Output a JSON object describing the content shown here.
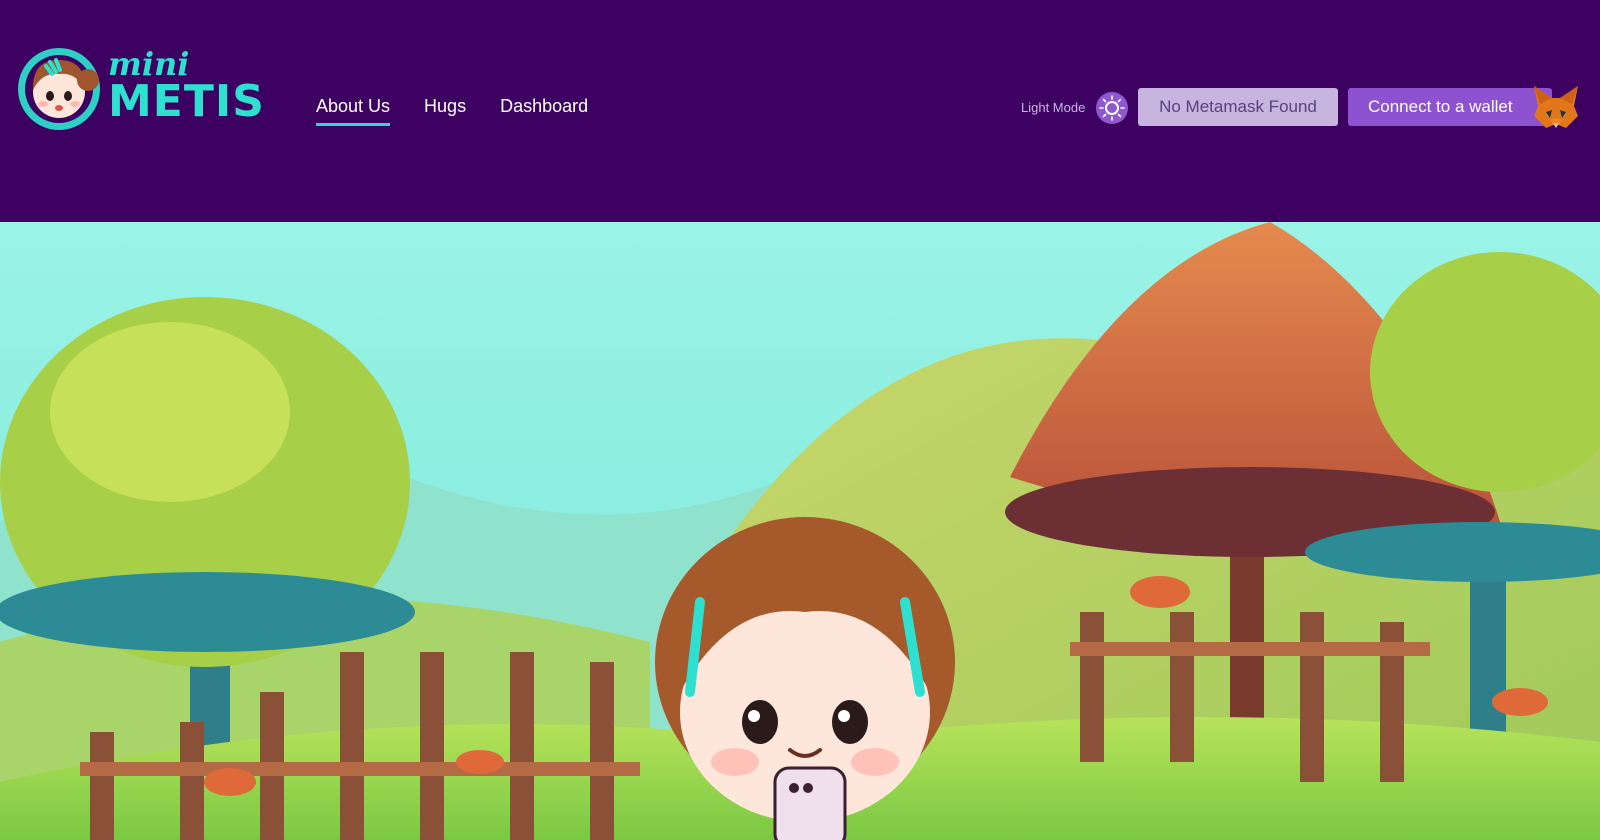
{
  "brand": {
    "mini": "mini",
    "metis": "METIS",
    "color": "#2de0cf"
  },
  "nav": {
    "items": [
      {
        "label": "About Us",
        "active": true
      },
      {
        "label": "Hugs",
        "active": false
      },
      {
        "label": "Dashboard",
        "active": false
      }
    ]
  },
  "header": {
    "light_mode_label": "Light Mode",
    "toggle_icon": "sun-icon",
    "no_metamask_label": "No Metamask Found",
    "connect_label": "Connect to a wallet",
    "wallet_icon": "metamask-fox-icon"
  },
  "colors": {
    "header_bg": "#3d0161",
    "accent_teal": "#33d7d0",
    "button_purple": "#8c52cf",
    "button_disabled": "#c7b4df"
  },
  "hero": {
    "illustration": "mushroom-forest-scene-with-chibi-girl"
  }
}
